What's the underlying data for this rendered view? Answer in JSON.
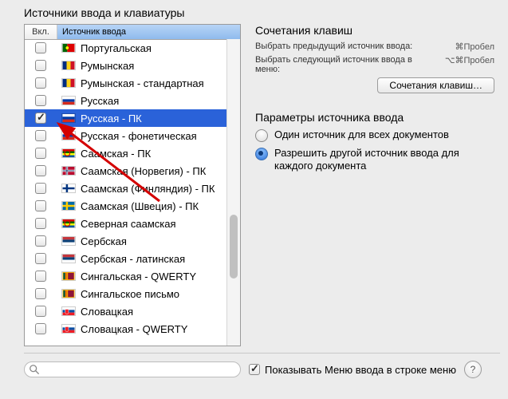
{
  "title": "Источники ввода и клавиатуры",
  "list": {
    "header_on": "Вкл.",
    "header_name": "Источник ввода",
    "items": [
      {
        "label": "Португальская",
        "checked": false,
        "flag": "pt"
      },
      {
        "label": "Румынская",
        "checked": false,
        "flag": "ro"
      },
      {
        "label": "Румынская - стандартная",
        "checked": false,
        "flag": "ro"
      },
      {
        "label": "Русская",
        "checked": false,
        "flag": "ru"
      },
      {
        "label": "Русская - ПК",
        "checked": true,
        "flag": "ru",
        "selected": true
      },
      {
        "label": "Русская - фонетическая",
        "checked": false,
        "flag": "ru"
      },
      {
        "label": "Саамская - ПК",
        "checked": false,
        "flag": "sami"
      },
      {
        "label": "Саамская (Норвегия) - ПК",
        "checked": false,
        "flag": "no"
      },
      {
        "label": "Саамская (Финляндия) - ПК",
        "checked": false,
        "flag": "fi"
      },
      {
        "label": "Саамская (Швеция) - ПК",
        "checked": false,
        "flag": "se"
      },
      {
        "label": "Северная саамская",
        "checked": false,
        "flag": "sami"
      },
      {
        "label": "Сербская",
        "checked": false,
        "flag": "rs"
      },
      {
        "label": "Сербская - латинская",
        "checked": false,
        "flag": "rs"
      },
      {
        "label": "Сингальская - QWERTY",
        "checked": false,
        "flag": "lk"
      },
      {
        "label": "Сингальское письмо",
        "checked": false,
        "flag": "lk"
      },
      {
        "label": "Словацкая",
        "checked": false,
        "flag": "sk"
      },
      {
        "label": "Словацкая - QWERTY",
        "checked": false,
        "flag": "sk"
      }
    ]
  },
  "shortcuts": {
    "title": "Сочетания клавиш",
    "prev_label": "Выбрать предыдущий источник ввода:",
    "prev_value": "⌘Пробел",
    "next_label": "Выбрать следующий источник ввода в меню:",
    "next_value": "⌥⌘Пробел",
    "button": "Сочетания клавиш…"
  },
  "params": {
    "title": "Параметры источника ввода",
    "opt_single": "Один источник для всех документов",
    "opt_each": "Разрешить другой источник ввода для каждого документа",
    "selected": "each"
  },
  "bottom": {
    "search_placeholder": "",
    "show_menu_label": "Показывать Меню ввода в строке меню",
    "show_menu_checked": true
  }
}
